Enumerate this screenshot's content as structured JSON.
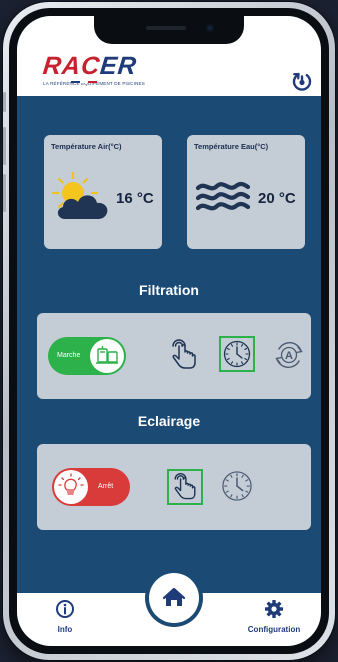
{
  "header": {
    "brand_name": "RACER",
    "brand_tagline": "LA RÉFÉRENCE ÉQUIPEMENT DE PISCINES",
    "power_icon": "power-refresh-icon"
  },
  "temperatures": {
    "air": {
      "label": "Température Air(°C)",
      "value": "16 °C",
      "icon": "sun-cloud-icon"
    },
    "water": {
      "label": "Température Eau(°C)",
      "value": "20 °C",
      "icon": "water-waves-icon"
    }
  },
  "filtration": {
    "title": "Filtration",
    "toggle_label": "Marche",
    "toggle_on": true,
    "modes": [
      {
        "name": "manual",
        "icon": "hand-tap-icon",
        "active": false
      },
      {
        "name": "timer",
        "icon": "clock-icon",
        "active": true
      },
      {
        "name": "auto",
        "icon": "auto-cycle-icon",
        "active": false
      }
    ]
  },
  "lighting": {
    "title": "Eclairage",
    "toggle_label": "Arrêt",
    "toggle_on": false,
    "modes": [
      {
        "name": "manual",
        "icon": "hand-tap-icon",
        "active": true
      },
      {
        "name": "timer",
        "icon": "clock-icon",
        "active": false
      }
    ]
  },
  "nav": {
    "info_label": "Info",
    "home_icon": "home-icon",
    "config_label": "Configuration"
  },
  "colors": {
    "app_blue": "#1b4a74",
    "card_gray": "#c4ccd6",
    "on_green": "#2db14a",
    "off_red": "#d93a3a",
    "brand_red": "#c8202f",
    "brand_navy": "#1f3b7a"
  }
}
